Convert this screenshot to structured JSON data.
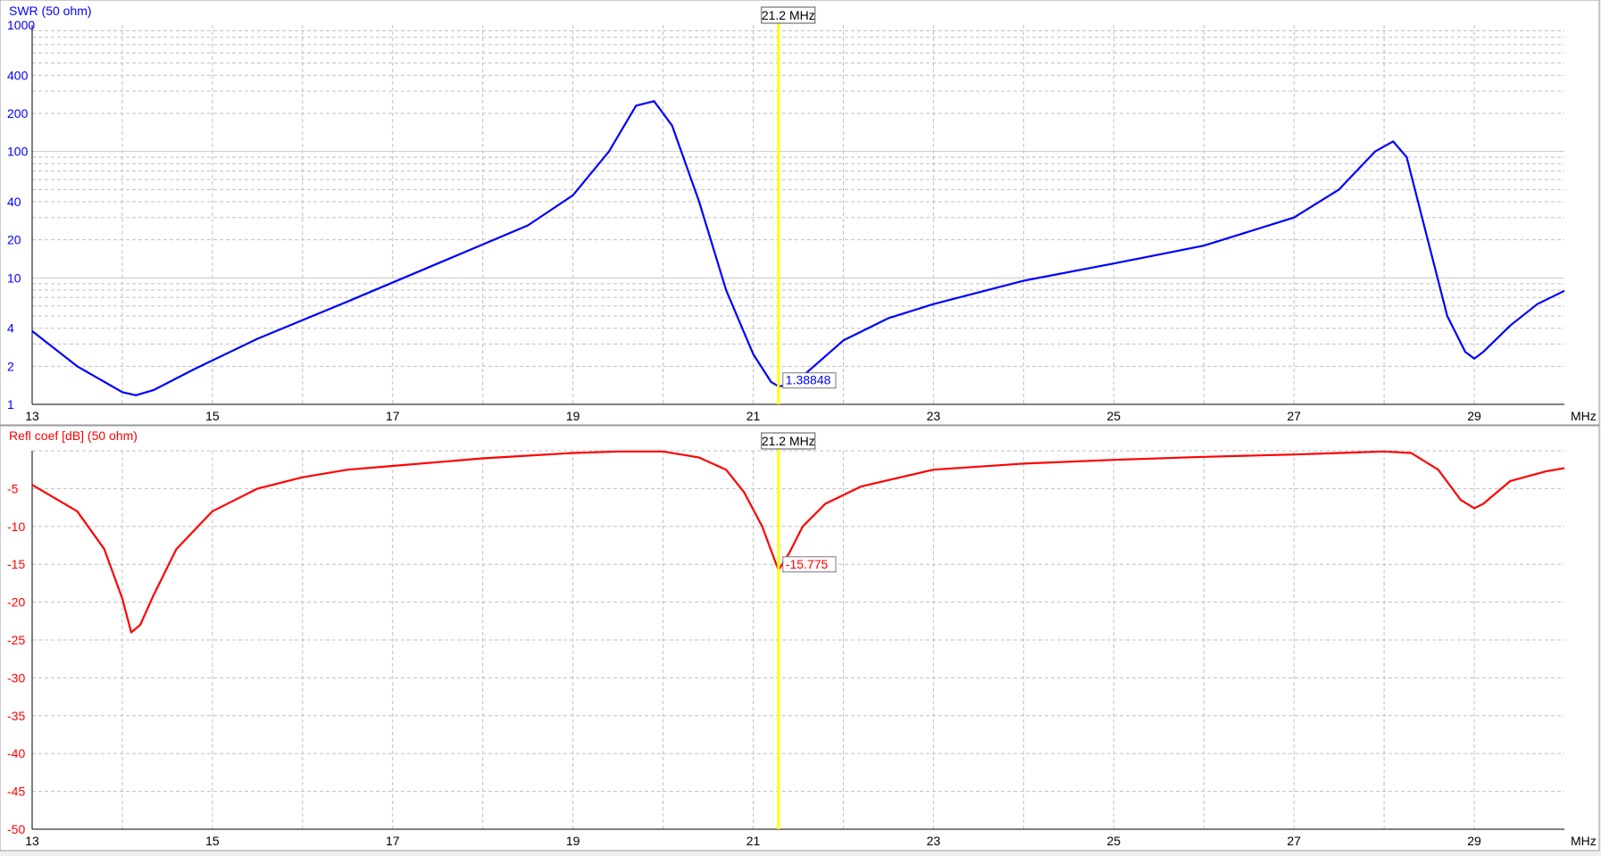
{
  "freq_unit": "MHz",
  "marker_label": "21.2 MHz",
  "colors": {
    "swr": "#0000ff",
    "refl": "#ff0000",
    "marker": "#ffff00",
    "grid": "#bfbfbf",
    "background": "#ffffff"
  },
  "chart_data": [
    {
      "type": "line",
      "title": "SWR (50 ohm)",
      "yscale": "log",
      "xlim": [
        13,
        30
      ],
      "ylim": [
        1,
        1000
      ],
      "x_ticks": [
        "13",
        "15",
        "17",
        "19",
        "21",
        "23",
        "25",
        "27",
        "29"
      ],
      "y_ticks": [
        "1000",
        "400",
        "200",
        "100",
        "40",
        "20",
        "10",
        "4",
        "2",
        "1"
      ],
      "x_label": "MHz",
      "marker": {
        "x": 21.28,
        "label": "21.2 MHz",
        "value_label": "1.38848"
      },
      "series": [
        {
          "color": "#0000ff",
          "x": [
            13.0,
            13.5,
            14.0,
            14.15,
            14.35,
            14.8,
            15.5,
            16.5,
            17.5,
            18.5,
            19.0,
            19.4,
            19.7,
            19.9,
            20.1,
            20.4,
            20.7,
            21.0,
            21.2,
            21.28,
            21.45,
            21.6,
            22.0,
            22.5,
            23.0,
            24.0,
            25.0,
            26.0,
            27.0,
            27.5,
            27.9,
            28.1,
            28.25,
            28.45,
            28.7,
            28.9,
            29.0,
            29.1,
            29.4,
            29.7,
            30.0
          ],
          "y": [
            3.8,
            2.0,
            1.25,
            1.18,
            1.3,
            1.9,
            3.3,
            6.5,
            13.0,
            26.0,
            45.0,
            100.0,
            230.0,
            250.0,
            160.0,
            40.0,
            8.0,
            2.5,
            1.5,
            1.39,
            1.42,
            1.8,
            3.2,
            4.8,
            6.2,
            9.5,
            13.0,
            18.0,
            30.0,
            50.0,
            100.0,
            120.0,
            90.0,
            25.0,
            5.0,
            2.6,
            2.3,
            2.6,
            4.2,
            6.2,
            7.9
          ]
        }
      ]
    },
    {
      "type": "line",
      "title": "Refl coef [dB] (50 ohm)",
      "xlim": [
        13,
        30
      ],
      "ylim": [
        -50,
        0
      ],
      "x_ticks": [
        "13",
        "15",
        "17",
        "19",
        "21",
        "23",
        "25",
        "27",
        "29"
      ],
      "y_ticks": [
        "-5",
        "-10",
        "-15",
        "-20",
        "-25",
        "-30",
        "-35",
        "-40",
        "-45",
        "-50"
      ],
      "x_label": "MHz",
      "marker": {
        "x": 21.28,
        "label": "21.2 MHz",
        "value_label": "-15.775"
      },
      "series": [
        {
          "color": "#ff0000",
          "x": [
            13.0,
            13.5,
            13.8,
            14.0,
            14.1,
            14.2,
            14.35,
            14.6,
            15.0,
            15.5,
            16.0,
            16.5,
            17.0,
            18.0,
            19.0,
            19.5,
            20.0,
            20.4,
            20.7,
            20.9,
            21.1,
            21.28,
            21.4,
            21.55,
            21.8,
            22.2,
            23.0,
            24.0,
            25.0,
            26.0,
            27.0,
            27.5,
            28.0,
            28.3,
            28.6,
            28.85,
            29.0,
            29.1,
            29.4,
            29.8,
            30.0
          ],
          "y": [
            -4.5,
            -8.0,
            -13.0,
            -19.5,
            -24.0,
            -23.0,
            -19.0,
            -13.0,
            -8.0,
            -5.0,
            -3.5,
            -2.5,
            -2.0,
            -1.0,
            -0.3,
            -0.1,
            -0.1,
            -0.9,
            -2.5,
            -5.5,
            -10.0,
            -15.775,
            -13.5,
            -10.0,
            -7.0,
            -4.7,
            -2.5,
            -1.7,
            -1.2,
            -0.8,
            -0.5,
            -0.3,
            -0.1,
            -0.3,
            -2.5,
            -6.5,
            -7.6,
            -7.0,
            -4.0,
            -2.7,
            -2.3
          ]
        }
      ]
    }
  ]
}
